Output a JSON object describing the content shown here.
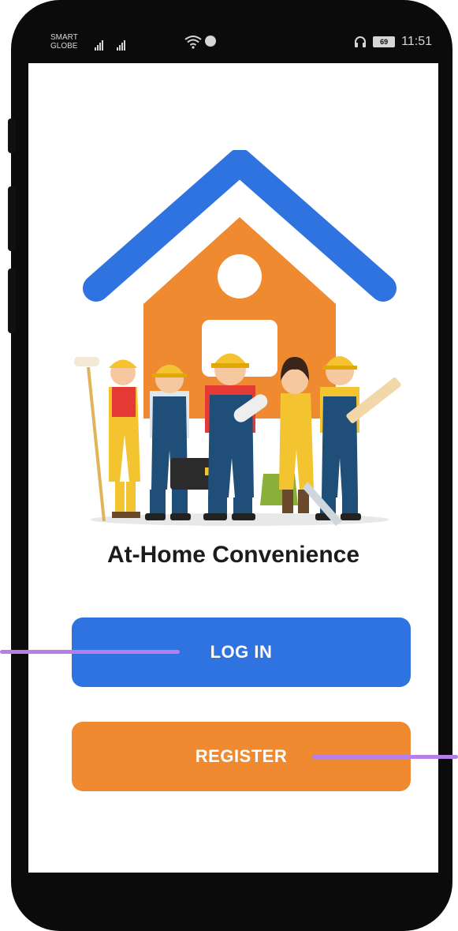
{
  "status_bar": {
    "carrier": "SMART GLOBE",
    "battery": "69",
    "time": "11:51"
  },
  "app": {
    "title": "At-Home Convenience",
    "login_label": "LOG IN",
    "register_label": "REGISTER"
  },
  "colors": {
    "primary_blue": "#2f73e0",
    "accent_orange": "#ef8a30",
    "pointer_purple": "#b57ee8"
  }
}
